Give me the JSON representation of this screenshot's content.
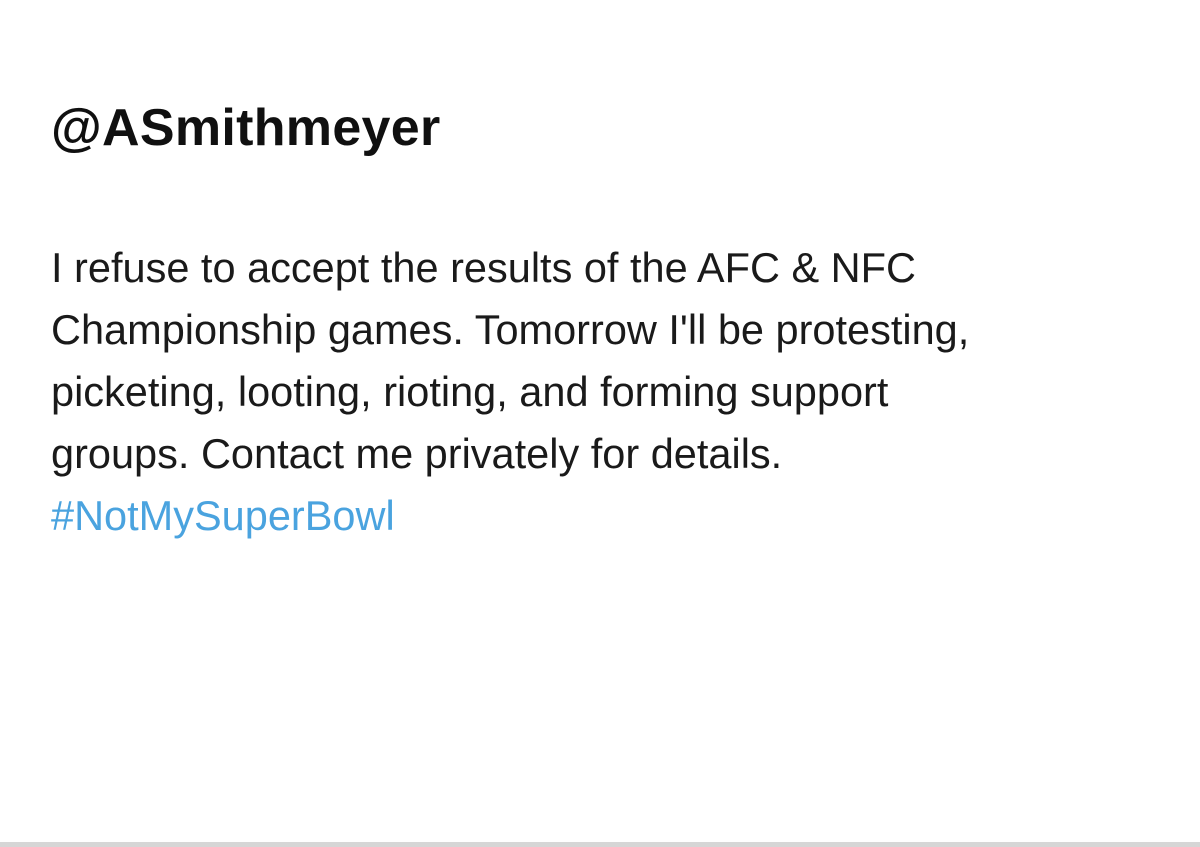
{
  "tweet": {
    "handle": "@ASmithmeyer",
    "text_lines": [
      "I refuse to accept the results of the AFC & NFC",
      "Championship games. Tomorrow I'll be protesting,",
      "picketing, looting, rioting, and forming support",
      "groups. Contact me privately for details."
    ],
    "hashtag": "#NotMySuperBowl"
  },
  "colors": {
    "background": "#ffffff",
    "text": "#1a1a1a",
    "hashtag": "#4aa3df",
    "border": "#d6d6d6"
  }
}
